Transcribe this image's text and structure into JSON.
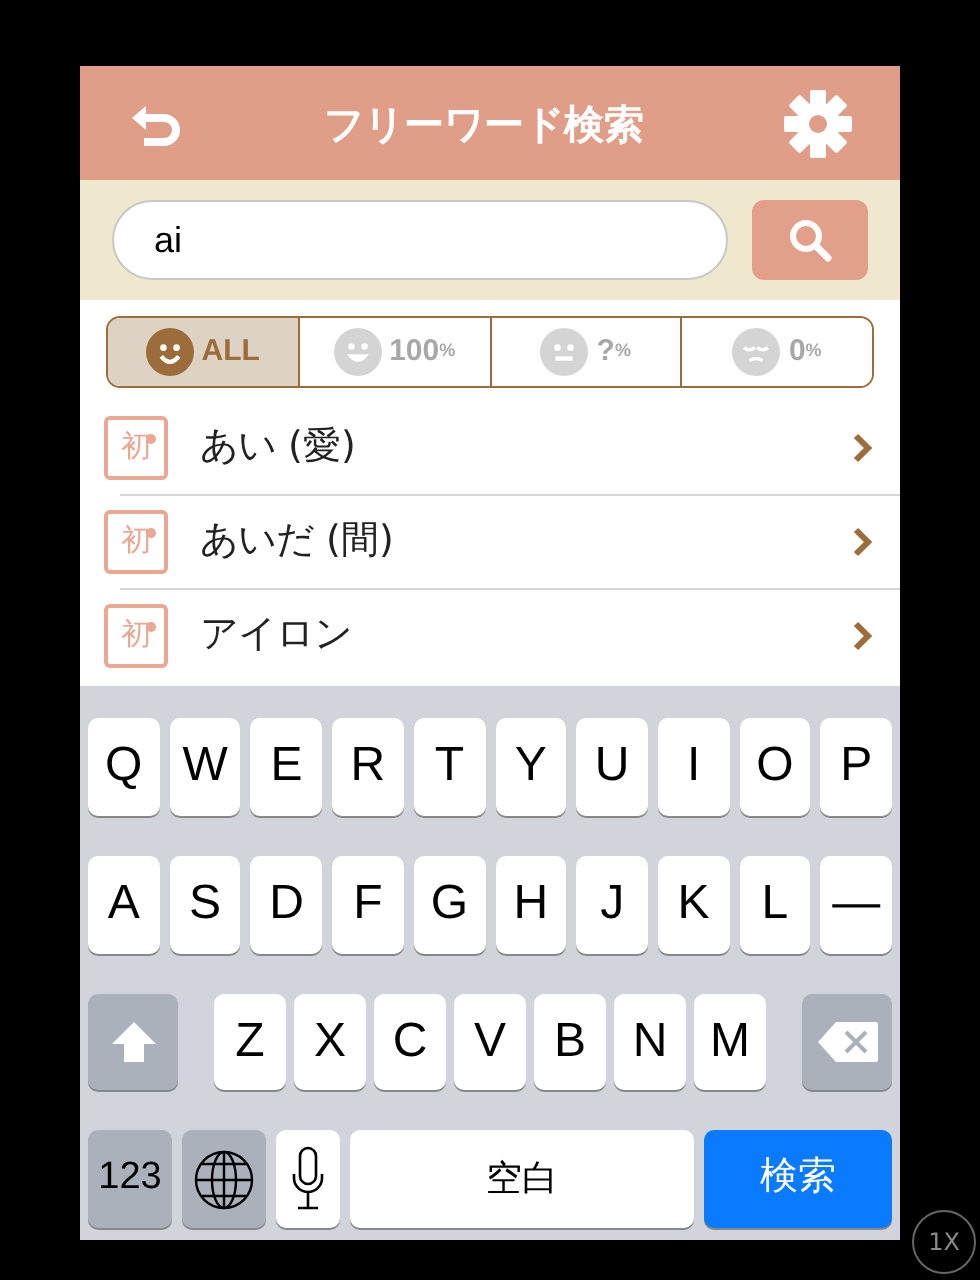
{
  "header": {
    "title": "フリーワード検索"
  },
  "search": {
    "value": "ai"
  },
  "filters": [
    {
      "kind": "all",
      "label": "ALL",
      "selected": true
    },
    {
      "kind": "happy",
      "label": "100",
      "unit": "%",
      "selected": false
    },
    {
      "kind": "neutral",
      "label": "?",
      "unit": "%",
      "selected": false
    },
    {
      "kind": "sad",
      "label": "0",
      "unit": "%",
      "selected": false
    }
  ],
  "results": [
    {
      "badge": "初",
      "word": "あい (愛)"
    },
    {
      "badge": "初",
      "word": "あいだ (間)"
    },
    {
      "badge": "初",
      "word": "アイロン"
    }
  ],
  "keyboard": {
    "rows": [
      {
        "keys": [
          {
            "kind": "letter",
            "label": "Q"
          },
          {
            "kind": "letter",
            "label": "W"
          },
          {
            "kind": "letter",
            "label": "E"
          },
          {
            "kind": "letter",
            "label": "R"
          },
          {
            "kind": "letter",
            "label": "T"
          },
          {
            "kind": "letter",
            "label": "Y"
          },
          {
            "kind": "letter",
            "label": "U"
          },
          {
            "kind": "letter",
            "label": "I"
          },
          {
            "kind": "letter",
            "label": "O"
          },
          {
            "kind": "letter",
            "label": "P"
          }
        ]
      },
      {
        "keys": [
          {
            "kind": "letter",
            "label": "A"
          },
          {
            "kind": "letter",
            "label": "S"
          },
          {
            "kind": "letter",
            "label": "D"
          },
          {
            "kind": "letter",
            "label": "F"
          },
          {
            "kind": "letter",
            "label": "G"
          },
          {
            "kind": "letter",
            "label": "H"
          },
          {
            "kind": "letter",
            "label": "J"
          },
          {
            "kind": "letter",
            "label": "K"
          },
          {
            "kind": "letter",
            "label": "L"
          },
          {
            "kind": "letter",
            "label": "—"
          }
        ]
      },
      {
        "keys": [
          {
            "kind": "shift"
          },
          {
            "kind": "letter",
            "label": "Z"
          },
          {
            "kind": "letter",
            "label": "X"
          },
          {
            "kind": "letter",
            "label": "C"
          },
          {
            "kind": "letter",
            "label": "V"
          },
          {
            "kind": "letter",
            "label": "B"
          },
          {
            "kind": "letter",
            "label": "N"
          },
          {
            "kind": "letter",
            "label": "M"
          },
          {
            "kind": "delete"
          }
        ]
      },
      {
        "keys": [
          {
            "kind": "numbers",
            "label": "123"
          },
          {
            "kind": "globe"
          },
          {
            "kind": "mic"
          },
          {
            "kind": "space",
            "label": "空白"
          },
          {
            "kind": "return",
            "label": "検索"
          }
        ]
      }
    ]
  },
  "zoom_badge": "1X"
}
